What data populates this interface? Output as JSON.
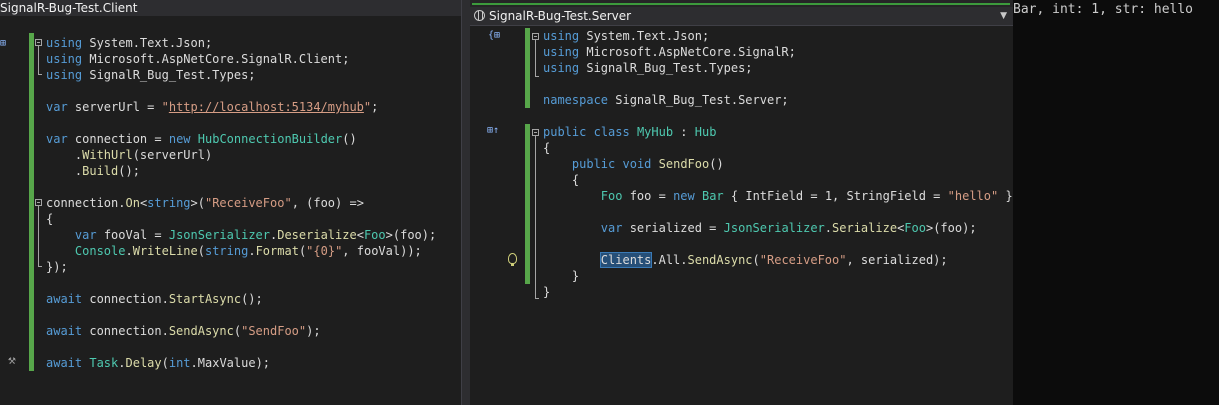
{
  "left": {
    "title": "SignalR-Bug-Test.Client",
    "lines": [
      [
        [
          "kw",
          "using"
        ],
        [
          "hl",
          " System.Text.Json;"
        ]
      ],
      [
        [
          "kw",
          "using"
        ],
        [
          "hl",
          " Microsoft.AspNetCore.SignalR.Client;"
        ]
      ],
      [
        [
          "kw",
          "using"
        ],
        [
          "hl",
          " SignalR_Bug_Test.Types;"
        ]
      ],
      [],
      [
        [
          "kw",
          "var"
        ],
        [
          "hl",
          " serverUrl = "
        ],
        [
          "st",
          "\""
        ],
        [
          "url",
          "http://localhost:5134/myhub"
        ],
        [
          "st",
          "\""
        ],
        [
          "hl",
          ";"
        ]
      ],
      [],
      [
        [
          "kw",
          "var"
        ],
        [
          "hl",
          " connection = "
        ],
        [
          "kw",
          "new"
        ],
        [
          "hl",
          " "
        ],
        [
          "ty",
          "HubConnectionBuilder"
        ],
        [
          "hl",
          "()"
        ]
      ],
      [
        [
          "hl",
          "    ."
        ],
        [
          "me",
          "WithUrl"
        ],
        [
          "hl",
          "(serverUrl)"
        ]
      ],
      [
        [
          "hl",
          "    ."
        ],
        [
          "me",
          "Build"
        ],
        [
          "hl",
          "();"
        ]
      ],
      [],
      [
        [
          "hl",
          "connection."
        ],
        [
          "me",
          "On"
        ],
        [
          "hl",
          "<"
        ],
        [
          "kw",
          "string"
        ],
        [
          "hl",
          ">("
        ],
        [
          "st",
          "\"ReceiveFoo\""
        ],
        [
          "hl",
          ", (foo) =>"
        ]
      ],
      [
        [
          "hl",
          "{"
        ]
      ],
      [
        [
          "hl",
          "    "
        ],
        [
          "kw",
          "var"
        ],
        [
          "hl",
          " fooVal = "
        ],
        [
          "ty",
          "JsonSerializer"
        ],
        [
          "hl",
          "."
        ],
        [
          "me",
          "Deserialize"
        ],
        [
          "hl",
          "<"
        ],
        [
          "ty",
          "Foo"
        ],
        [
          "hl",
          ">(foo);"
        ]
      ],
      [
        [
          "hl",
          "    "
        ],
        [
          "ty",
          "Console"
        ],
        [
          "hl",
          "."
        ],
        [
          "me",
          "WriteLine"
        ],
        [
          "hl",
          "("
        ],
        [
          "kw",
          "string"
        ],
        [
          "hl",
          "."
        ],
        [
          "me",
          "Format"
        ],
        [
          "hl",
          "("
        ],
        [
          "st",
          "\"{0}\""
        ],
        [
          "hl",
          ", fooVal));"
        ]
      ],
      [
        [
          "hl",
          "});"
        ]
      ],
      [],
      [
        [
          "kw",
          "await"
        ],
        [
          "hl",
          " connection."
        ],
        [
          "me",
          "StartAsync"
        ],
        [
          "hl",
          "();"
        ]
      ],
      [],
      [
        [
          "kw",
          "await"
        ],
        [
          "hl",
          " connection."
        ],
        [
          "me",
          "SendAsync"
        ],
        [
          "hl",
          "("
        ],
        [
          "st",
          "\"SendFoo\""
        ],
        [
          "hl",
          ");"
        ]
      ],
      [],
      [
        [
          "kw",
          "await"
        ],
        [
          "hl",
          " "
        ],
        [
          "ty",
          "Task"
        ],
        [
          "hl",
          "."
        ],
        [
          "me",
          "Delay"
        ],
        [
          "hl",
          "("
        ],
        [
          "kw",
          "int"
        ],
        [
          "hl",
          ".MaxValue);"
        ]
      ]
    ]
  },
  "right": {
    "title": "SignalR-Bug-Test.Server",
    "dropdown_icon": "chevron-down-icon",
    "lines": [
      [
        [
          "kw",
          "using"
        ],
        [
          "hl",
          " System.Text.Json;"
        ]
      ],
      [
        [
          "kw",
          "using"
        ],
        [
          "hl",
          " Microsoft.AspNetCore.SignalR;"
        ]
      ],
      [
        [
          "kw",
          "using"
        ],
        [
          "hl",
          " SignalR_Bug_Test.Types;"
        ]
      ],
      [],
      [
        [
          "kw",
          "namespace"
        ],
        [
          "hl",
          " SignalR_Bug_Test.Server;"
        ]
      ],
      [],
      [
        [
          "kw",
          "public"
        ],
        [
          "hl",
          " "
        ],
        [
          "kw",
          "class"
        ],
        [
          "hl",
          " "
        ],
        [
          "ty",
          "MyHub"
        ],
        [
          "hl",
          " : "
        ],
        [
          "ty",
          "Hub"
        ]
      ],
      [
        [
          "hl",
          "{"
        ]
      ],
      [
        [
          "hl",
          "    "
        ],
        [
          "kw",
          "public"
        ],
        [
          "hl",
          " "
        ],
        [
          "kw",
          "void"
        ],
        [
          "hl",
          " "
        ],
        [
          "me",
          "SendFoo"
        ],
        [
          "hl",
          "()"
        ]
      ],
      [
        [
          "hl",
          "    {"
        ]
      ],
      [
        [
          "hl",
          "        "
        ],
        [
          "ty",
          "Foo"
        ],
        [
          "hl",
          " foo = "
        ],
        [
          "kw",
          "new"
        ],
        [
          "hl",
          " "
        ],
        [
          "ty",
          "Bar"
        ],
        [
          "hl",
          " { IntField = 1, StringField = "
        ],
        [
          "st",
          "\"hello\""
        ],
        [
          "hl",
          " };"
        ]
      ],
      [],
      [
        [
          "hl",
          "        "
        ],
        [
          "kw",
          "var"
        ],
        [
          "hl",
          " serialized = "
        ],
        [
          "ty",
          "JsonSerializer"
        ],
        [
          "hl",
          "."
        ],
        [
          "me",
          "Serialize"
        ],
        [
          "hl",
          "<"
        ],
        [
          "ty",
          "Foo"
        ],
        [
          "hl",
          ">(foo);"
        ]
      ],
      [],
      [
        [
          "hl",
          "        "
        ],
        [
          "sel",
          "Clients"
        ],
        [
          "hl",
          ".All."
        ],
        [
          "me",
          "SendAsync"
        ],
        [
          "hl",
          "("
        ],
        [
          "st",
          "\"ReceiveFoo\""
        ],
        [
          "hl",
          ", serialized);"
        ]
      ],
      [
        [
          "hl",
          "    }"
        ]
      ],
      [
        [
          "hl",
          "}"
        ]
      ]
    ]
  },
  "console": {
    "text": "Bar, int: 1, str: hello"
  },
  "colors": {
    "editor_bg": "#1e1e1e",
    "keyword": "#569cd6",
    "type": "#4ec9b0",
    "string": "#d69d85",
    "method": "#dcdcaa",
    "change_bar": "#57a64a"
  }
}
